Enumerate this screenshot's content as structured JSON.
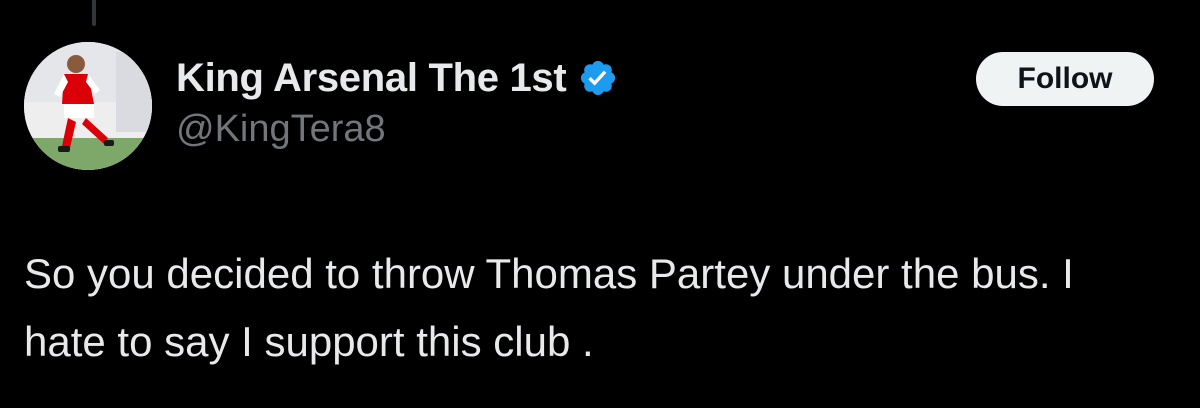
{
  "post": {
    "author": {
      "display_name": "King Arsenal The 1st",
      "handle": "@KingTera8",
      "verified": true,
      "avatar": "arsenal-player-avatar"
    },
    "follow_label": "Follow",
    "text": "So you decided to throw Thomas Partey under the bus. I hate to say I support this club ."
  },
  "colors": {
    "background": "#000000",
    "text_primary": "#e7e9ea",
    "text_secondary": "#71767b",
    "verified_badge": "#1d9bf0",
    "follow_button_bg": "#eff3f4",
    "follow_button_text": "#0f1419"
  },
  "icons": {
    "verified": "verified-badge-icon"
  }
}
